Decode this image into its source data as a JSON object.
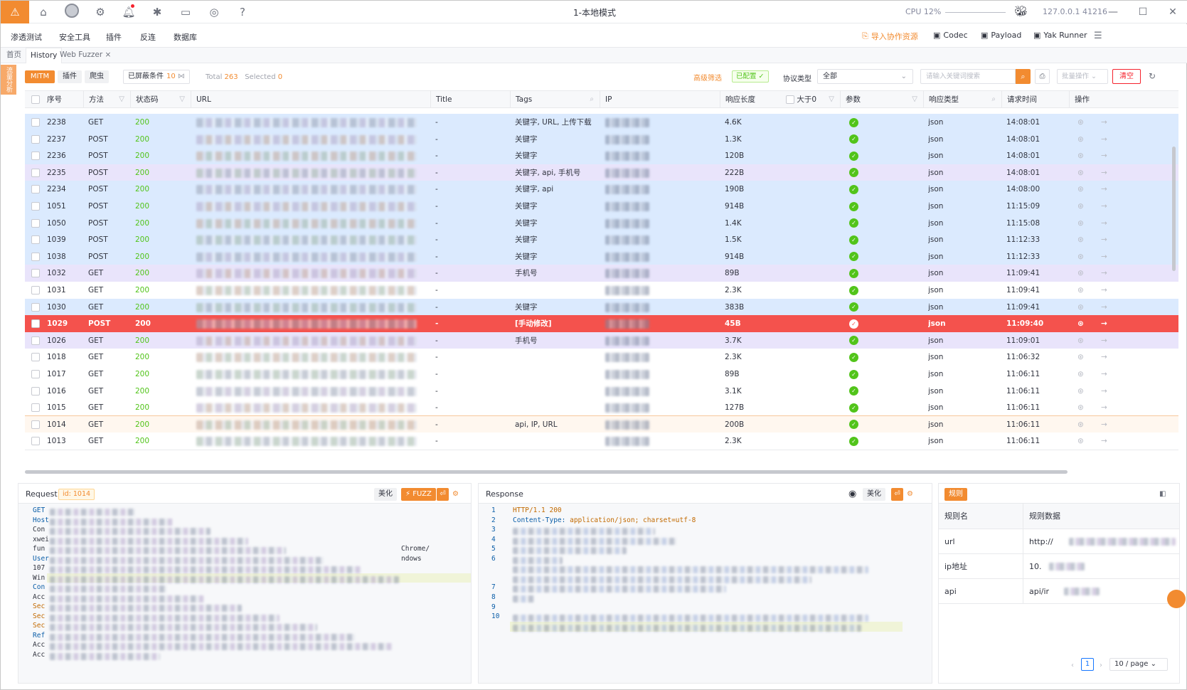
{
  "app": {
    "title": "1-本地模式",
    "cpu": "CPU 12%",
    "host": "127.0.0.1 41216"
  },
  "icons": [
    "home-icon",
    "user-icon",
    "gear-icon",
    "bell-icon",
    "bug-icon",
    "terminal-icon",
    "camera-icon",
    "help-icon"
  ],
  "menu": {
    "items": [
      "渗透测试",
      "安全工具",
      "插件",
      "反连",
      "数据库"
    ],
    "import": "导入协作资源",
    "codec": "Codec",
    "payload": "Payload",
    "yak_runner": "Yak Runner"
  },
  "tabs": {
    "home": "首页",
    "history": "History",
    "fuzzer": "Web Fuzzer"
  },
  "side_tab": "流量分析",
  "toolbar": {
    "mitm": "MITM",
    "plugin": "插件",
    "crawler": "爬虫",
    "filtered_label": "已屏蔽条件",
    "filtered_count": "10",
    "total_label": "Total",
    "total": "263",
    "selected_label": "Selected",
    "selected": "0",
    "advanced": "高级筛选",
    "configured": "已配置",
    "protocol_label": "协议类型",
    "protocol_value": "全部",
    "search_placeholder": "请输入关键词搜索",
    "batch": "批量操作",
    "clear": "清空"
  },
  "columns": {
    "no": "序号",
    "method": "方法",
    "status": "状态码",
    "url": "URL",
    "title": "Title",
    "tags": "Tags",
    "ip": "IP",
    "resp_len": "响应长度",
    "gt0": "大于0",
    "params": "参数",
    "resp_type": "响应类型",
    "req_time": "请求时间",
    "ops": "操作"
  },
  "rows": [
    {
      "id": "2238",
      "method": "GET",
      "status": "200",
      "title": "-",
      "tags": "关键字, URL, 上传下载",
      "len": "4.6K",
      "type": "json",
      "time": "14:08:01",
      "bg": "#dbeafe"
    },
    {
      "id": "2237",
      "method": "POST",
      "status": "200",
      "title": "-",
      "tags": "关键字",
      "len": "1.3K",
      "type": "json",
      "time": "14:08:01",
      "bg": "#dbeafe"
    },
    {
      "id": "2236",
      "method": "POST",
      "status": "200",
      "title": "-",
      "tags": "关键字",
      "len": "120B",
      "type": "json",
      "time": "14:08:01",
      "bg": "#dbeafe"
    },
    {
      "id": "2235",
      "method": "POST",
      "status": "200",
      "title": "-",
      "tags": "关键字, api, 手机号",
      "len": "222B",
      "type": "json",
      "time": "14:08:01",
      "bg": "#e9e4fb"
    },
    {
      "id": "2234",
      "method": "POST",
      "status": "200",
      "title": "-",
      "tags": "关键字, api",
      "len": "190B",
      "type": "json",
      "time": "14:08:00",
      "bg": "#dbeafe"
    },
    {
      "id": "1051",
      "method": "POST",
      "status": "200",
      "title": "-",
      "tags": "关键字",
      "len": "914B",
      "type": "json",
      "time": "11:15:09",
      "bg": "#dbeafe"
    },
    {
      "id": "1050",
      "method": "POST",
      "status": "200",
      "title": "-",
      "tags": "关键字",
      "len": "1.4K",
      "type": "json",
      "time": "11:15:08",
      "bg": "#dbeafe"
    },
    {
      "id": "1039",
      "method": "POST",
      "status": "200",
      "title": "-",
      "tags": "关键字",
      "len": "1.5K",
      "type": "json",
      "time": "11:12:33",
      "bg": "#dbeafe"
    },
    {
      "id": "1038",
      "method": "POST",
      "status": "200",
      "title": "-",
      "tags": "关键字",
      "len": "914B",
      "type": "json",
      "time": "11:12:33",
      "bg": "#dbeafe"
    },
    {
      "id": "1032",
      "method": "GET",
      "status": "200",
      "title": "-",
      "tags": "手机号",
      "len": "89B",
      "type": "json",
      "time": "11:09:41",
      "bg": "#e9e4fb"
    },
    {
      "id": "1031",
      "method": "GET",
      "status": "200",
      "title": "-",
      "tags": "",
      "len": "2.3K",
      "type": "json",
      "time": "11:09:41",
      "bg": "#ffffff"
    },
    {
      "id": "1030",
      "method": "GET",
      "status": "200",
      "title": "-",
      "tags": "关键字",
      "len": "383B",
      "type": "json",
      "time": "11:09:41",
      "bg": "#dbeafe"
    },
    {
      "id": "1029",
      "method": "POST",
      "status": "200",
      "title": "-",
      "tags": "[手动修改]",
      "len": "45B",
      "type": "json",
      "time": "11:09:40",
      "bg": "#f4524d",
      "selected": true
    },
    {
      "id": "1026",
      "method": "GET",
      "status": "200",
      "title": "-",
      "tags": "手机号",
      "len": "3.7K",
      "type": "json",
      "time": "11:09:01",
      "bg": "#e9e4fb"
    },
    {
      "id": "1018",
      "method": "GET",
      "status": "200",
      "title": "-",
      "tags": "",
      "len": "2.3K",
      "type": "json",
      "time": "11:06:32",
      "bg": "#ffffff"
    },
    {
      "id": "1017",
      "method": "GET",
      "status": "200",
      "title": "-",
      "tags": "",
      "len": "89B",
      "type": "json",
      "time": "11:06:11",
      "bg": "#ffffff"
    },
    {
      "id": "1016",
      "method": "GET",
      "status": "200",
      "title": "-",
      "tags": "",
      "len": "3.1K",
      "type": "json",
      "time": "11:06:11",
      "bg": "#ffffff"
    },
    {
      "id": "1015",
      "method": "GET",
      "status": "200",
      "title": "-",
      "tags": "",
      "len": "127B",
      "type": "json",
      "time": "11:06:11",
      "bg": "#ffffff"
    },
    {
      "id": "1014",
      "method": "GET",
      "status": "200",
      "title": "-",
      "tags": "api, IP, URL",
      "len": "200B",
      "type": "json",
      "time": "11:06:11",
      "bg": "#fff7ef",
      "hover": true
    },
    {
      "id": "1013",
      "method": "GET",
      "status": "200",
      "title": "-",
      "tags": "",
      "len": "2.3K",
      "type": "json",
      "time": "11:06:11",
      "bg": "#ffffff"
    }
  ],
  "request": {
    "title": "Request",
    "id_tag": "id: 1014",
    "beautify": "美化",
    "fuzz": "FUZZ",
    "lines": [
      "GET",
      "Host",
      "Con",
      "xwei",
      "fun",
      "User",
      "107",
      "Win",
      "Con",
      "Acc",
      "Sec",
      "Sec",
      "Sec",
      "Ref",
      "Acc",
      "Acc"
    ],
    "ua_tail": "Chrome/",
    "ua_tail2": "ndows"
  },
  "response": {
    "title": "Response",
    "beautify": "美化",
    "line1": "HTTP/1.1 200",
    "line2_key": "Content-Type:",
    "line2_val": "application/json; charset=utf-8",
    "line_numbers": [
      "1",
      "2",
      "3",
      "4",
      "5",
      "6",
      "7",
      "8",
      "9",
      "10"
    ]
  },
  "rules": {
    "tag": "规则",
    "col_name": "规则名",
    "col_data": "规则数据",
    "rows": [
      {
        "name": "url",
        "data": "http://"
      },
      {
        "name": "ip地址",
        "data": "10."
      },
      {
        "name": "api",
        "data": "api/ir"
      }
    ],
    "page": "1",
    "page_size": "10 / page"
  }
}
